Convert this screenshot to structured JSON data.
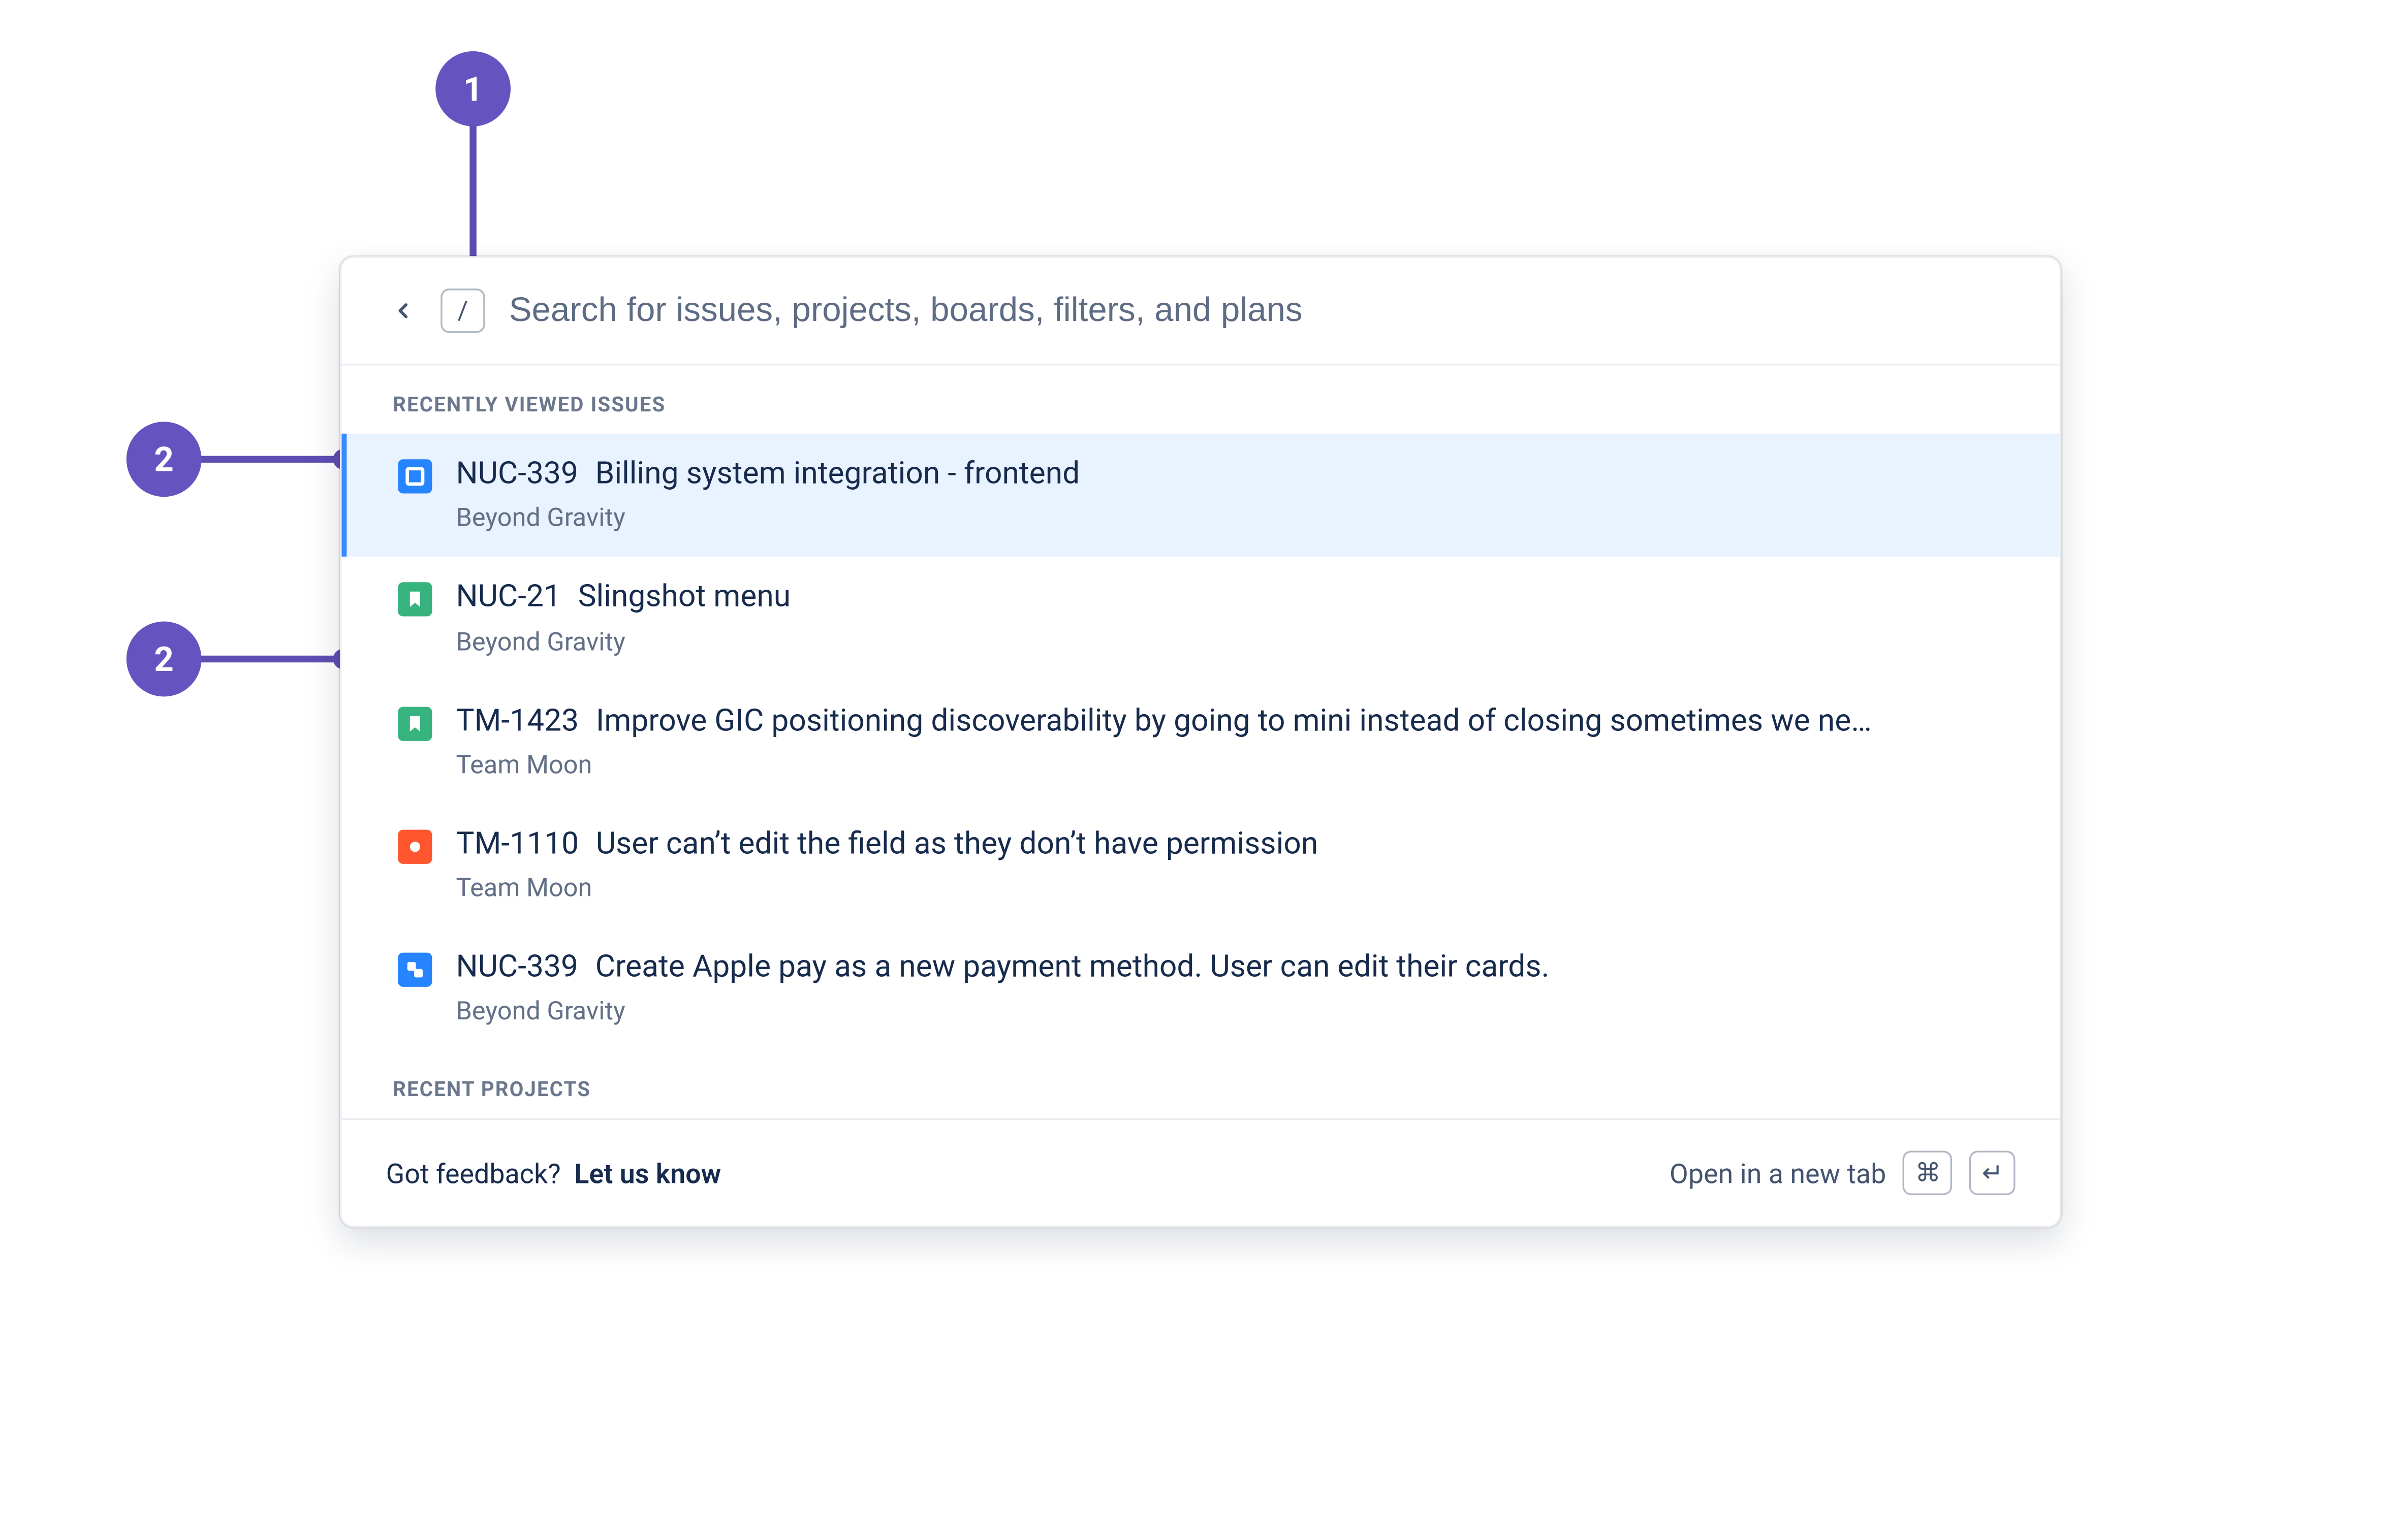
{
  "annotations": {
    "a1": "1",
    "a2": "2",
    "a3": "2"
  },
  "search": {
    "placeholder": "Search for issues, projects, boards, filters, and plans",
    "shortcut": "/"
  },
  "sections": {
    "recent_issues_header": "RECENTLY VIEWED ISSUES",
    "recent_projects_header": "RECENT PROJECTS"
  },
  "issues": [
    {
      "key": "NUC-339",
      "summary": "Billing system integration - frontend",
      "project": "Beyond Gravity",
      "type": "task",
      "selected": true
    },
    {
      "key": "NUC-21",
      "summary": "Slingshot menu",
      "project": "Beyond Gravity",
      "type": "story",
      "selected": false
    },
    {
      "key": "TM-1423",
      "summary": "Improve GIC positioning discoverability by going to mini instead of closing sometimes we ne…",
      "project": "Team Moon",
      "type": "story",
      "selected": false
    },
    {
      "key": "TM-1110",
      "summary": "User can’t edit the field as they don’t have permission",
      "project": "Team Moon",
      "type": "bug",
      "selected": false
    },
    {
      "key": "NUC-339",
      "summary": "Create Apple pay as a new payment method. User can edit their cards.",
      "project": "Beyond Gravity",
      "type": "subtask",
      "selected": false
    }
  ],
  "footer": {
    "feedback_prefix": "Got feedback?",
    "feedback_link": "Let us know",
    "open_new_tab": "Open in a new tab",
    "shortcut_cmd": "⌘",
    "shortcut_enter": "↵"
  },
  "icon_colors": {
    "task": "#2684FF",
    "story": "#36B37E",
    "bug": "#FF5630",
    "subtask": "#2684FF"
  }
}
